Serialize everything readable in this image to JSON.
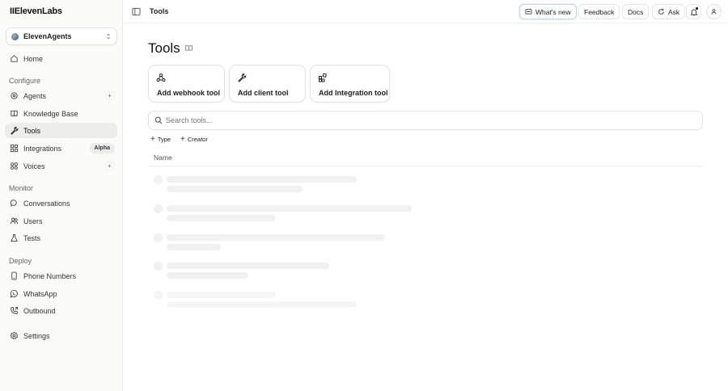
{
  "app": {
    "logo": "IIElevenLabs",
    "workspace": "ElevenAgents"
  },
  "sidebar": {
    "home": "Home",
    "sections": {
      "configure": "Configure",
      "monitor": "Monitor",
      "deploy": "Deploy"
    },
    "items": {
      "agents": "Agents",
      "knowledge_base": "Knowledge Base",
      "tools": "Tools",
      "integrations": "Integrations",
      "integrations_badge": "Alpha",
      "voices": "Voices",
      "conversations": "Conversations",
      "users": "Users",
      "tests": "Tests",
      "phone_numbers": "Phone Numbers",
      "whatsapp": "WhatsApp",
      "outbound": "Outbound",
      "settings": "Settings"
    },
    "plus": "+"
  },
  "topbar": {
    "title": "Tools",
    "whats_new": "What's new",
    "feedback": "Feedback",
    "docs": "Docs",
    "ask": "Ask"
  },
  "main": {
    "title": "Tools",
    "cards": {
      "webhook": "Add webhook tool",
      "client": "Add client tool",
      "integration": "Add Integration tool"
    },
    "search_placeholder": "Search tools...",
    "filters": {
      "type": "Type",
      "creator": "Creator"
    },
    "column_name": "Name"
  },
  "colors": {
    "accent": "#111111",
    "sidebar_bg": "#fbfbfa",
    "active_bg": "#ededec",
    "skeleton": "#f1f1f1"
  }
}
